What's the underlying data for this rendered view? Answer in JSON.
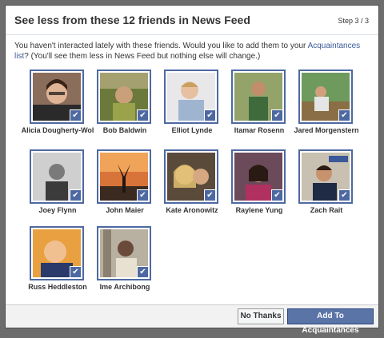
{
  "dialog": {
    "title": "See less from these 12 friends in News Feed",
    "step": "Step 3 / 3",
    "description_pre": "You haven't interacted lately with these friends. Would you like to add them to your ",
    "description_link": "Acquaintances list",
    "description_post": "? (You'll see them less in News Feed but nothing else will change.)"
  },
  "friends": [
    {
      "name": "Alicia Dougherty-Wol",
      "checked": true,
      "icon": "profile-photo"
    },
    {
      "name": "Bob Baldwin",
      "checked": true,
      "icon": "profile-photo"
    },
    {
      "name": "Elliot Lynde",
      "checked": true,
      "icon": "profile-photo"
    },
    {
      "name": "Itamar Rosenn",
      "checked": true,
      "icon": "profile-photo"
    },
    {
      "name": "Jared Morgenstern",
      "checked": true,
      "icon": "profile-photo"
    },
    {
      "name": "Joey Flynn",
      "checked": true,
      "icon": "profile-photo"
    },
    {
      "name": "John Maier",
      "checked": true,
      "icon": "profile-photo"
    },
    {
      "name": "Kate Aronowitz",
      "checked": true,
      "icon": "profile-photo"
    },
    {
      "name": "Raylene Yung",
      "checked": true,
      "icon": "profile-photo"
    },
    {
      "name": "Zach Rait",
      "checked": true,
      "icon": "profile-photo"
    },
    {
      "name": "Russ Heddleston",
      "checked": true,
      "icon": "profile-photo"
    },
    {
      "name": "Ime Archibong",
      "checked": true,
      "icon": "profile-photo"
    }
  ],
  "footer": {
    "no_thanks_label": "No Thanks",
    "add_label": "Add To Acquaintances"
  },
  "colors": {
    "accent": "#4e69a2",
    "primary_button": "#5b74a8",
    "link": "#3b5998"
  }
}
